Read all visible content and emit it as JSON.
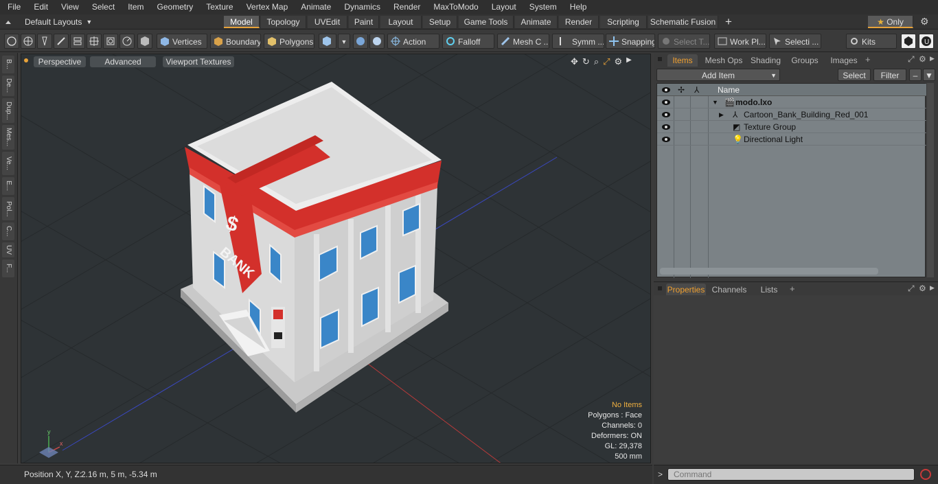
{
  "menu": [
    "File",
    "Edit",
    "View",
    "Select",
    "Item",
    "Geometry",
    "Texture",
    "Vertex Map",
    "Animate",
    "Dynamics",
    "Render",
    "MaxToModo",
    "Layout",
    "System",
    "Help"
  ],
  "layout_selector": "Default Layouts",
  "layout_tabs": [
    "Model",
    "Topology",
    "UVEdit",
    "Paint",
    "Layout",
    "Setup",
    "Game Tools",
    "Animate",
    "Render",
    "Scripting",
    "Schematic Fusion"
  ],
  "only_label": "Only",
  "toolbar": {
    "vertices": "Vertices",
    "boundary": "Boundary",
    "polygons": "Polygons",
    "action": "Action",
    "falloff": "Falloff",
    "mesh": "Mesh C ...",
    "symm": "Symm ...",
    "snapping": "Snapping",
    "select_t": "Select T...",
    "work_pl": "Work Pl...",
    "selecti": "Selecti ...",
    "kits": "Kits"
  },
  "left_tabs": [
    "B...",
    "De...",
    "Dup...",
    "Mes...",
    "Ve...",
    "E...",
    "Pol...",
    "C...",
    "UV",
    "F..."
  ],
  "viewport": {
    "perspective": "Perspective",
    "advanced": "Advanced",
    "viewport_textures": "Viewport Textures",
    "info": {
      "no_items": "No Items",
      "polygons": "Polygons : Face",
      "channels": "Channels: 0",
      "deformers": "Deformers: ON",
      "gl": "GL: 29,378",
      "scale": "500 mm"
    },
    "sign_text": "BANK",
    "sign_symbol": "$",
    "axis_x": "x",
    "axis_y": "y"
  },
  "items_panel": {
    "tabs": [
      "Items",
      "Mesh Ops",
      "Shading",
      "Groups",
      "Images"
    ],
    "add_item": "Add Item",
    "select": "Select",
    "filter": "Filter",
    "column_name": "Name",
    "rows": [
      "modo.lxo",
      "Cartoon_Bank_Building_Red_001",
      "Texture Group",
      "Directional Light"
    ]
  },
  "properties_panel": {
    "tabs": [
      "Properties",
      "Channels",
      "Lists"
    ]
  },
  "status": {
    "position_label": "Position X, Y, Z:",
    "position_value": "2.16 m, 5 m, -5.34 m"
  },
  "command": {
    "prompt": ">",
    "placeholder": "Command"
  },
  "colors": {
    "accent": "#e8a33a",
    "building_red": "#d3302b",
    "window_blue": "#3a86c8"
  }
}
